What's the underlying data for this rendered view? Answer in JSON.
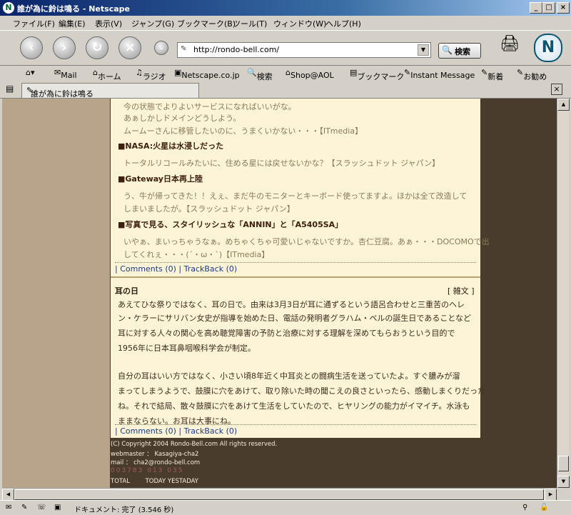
{
  "window": {
    "title": "誰が為に鈴は鳴る - Netscape"
  },
  "menu": [
    "ファイル(F)",
    "編集(E)",
    "表示(V)",
    "ジャンプ(G)",
    "ブックマーク(B)",
    "ツール(T)",
    "ウィンドウ(W)",
    "ヘルプ(H)"
  ],
  "nav": {
    "url": "http://rondo-bell.com/",
    "search_label": "検索"
  },
  "personal": [
    "Mail",
    "ホーム",
    "ラジオ",
    "Netscape.co.jp",
    "検索",
    "Shop@AOL",
    "ブックマーク",
    "Instant Message",
    "新着",
    "お勧め"
  ],
  "tab": {
    "title": "誰が為に鈴は鳴る"
  },
  "entries1": {
    "lines_top": [
      "今の状態でよりよいサービスになればいいがな。",
      "あぁしかしドメインどうしよう。",
      "ムームーさんに移管したいのに、うまくいかない・・・【ITmedia】"
    ],
    "news": [
      {
        "title": "■NASA:火星は水浸しだった",
        "lines": [
          "トータルリコールみたいに、住める星には戻せないかな？【スラッシュドット ジャパン】"
        ]
      },
      {
        "title": "■Gateway日本再上陸",
        "lines": [
          "う、牛が帰ってきた！！えぇ、まだ牛のモニターとキーボード使ってますよ。ほかは全て改造して",
          "しまいましたが。【スラッシュドット ジャパン】"
        ]
      },
      {
        "title": "■写真で見る、スタイリッシュな「ANNIN」と「A5405SA」",
        "lines": [
          "いやぁ、まいっちゃうなぁ。めちゃくちゃ可愛いじゃないですか。杏仁豆腐。あぁ・・・DOCOMOで出",
          "してくれぇ・・・(´・ω・`)【ITmedia】"
        ]
      }
    ],
    "meta": "| Comments (0) | TrackBack (0)"
  },
  "entry2": {
    "title": "耳の日",
    "category": "[ 雑文 ]",
    "lines": [
      "あえてひな祭りではなく、耳の日で。由来は3月3日が耳に通ずるという語呂合わせと三重苦のヘレ",
      "ン・ケラーにサリバン女史が指導を始めた日、電話の発明者グラハム・ベルの誕生日であることなど",
      "耳に対する人々の関心を高め聴覚障害の予防と治療に対する理解を深めてもらおうという目的で",
      "1956年に日本耳鼻咽喉科学会が制定。",
      "",
      "自分の耳はいい方ではなく、小さい頃8年近く中耳炎との闘病生活を送っていたよ。すぐ膿みが溜",
      "まってしまうようで、鼓膜に穴をあけて、取り除いた時の聞こえの良さといったら、感動しまくりだった",
      "ね。それで結局、散々鼓膜に穴をあけて生活をしていたので、ヒヤリングの能力がイマイチ。水泳も",
      "ままならない。お耳は大事にね。"
    ],
    "meta": "| Comments (0) | TrackBack (0)"
  },
  "footer": {
    "copyright": "(C) Copyright 2004 Rondo-Bell.com All rights reserved.",
    "webmaster": "webmaster ： Kasagiya-cha2",
    "mail": "mail ： cha2@rondo-bell.com",
    "counter": "003783 013   035",
    "counter_labels": "TOTAL        TODAY YESTADAY"
  },
  "status": {
    "text": "ドキュメント: 完了 (3.546 秒)"
  }
}
